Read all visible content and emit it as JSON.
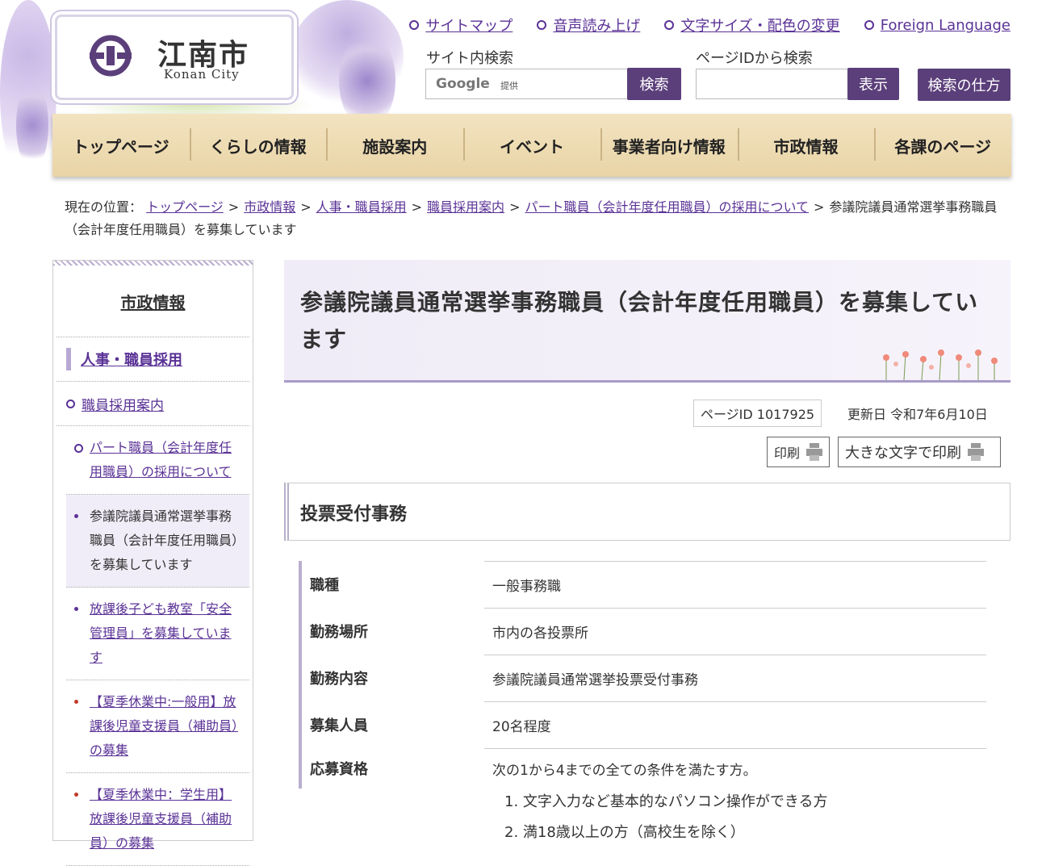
{
  "header": {
    "logo_text": "江南市",
    "logo_sub": "Konan City",
    "util_links": [
      "サイトマップ",
      "音声読み上げ",
      "文字サイズ・配色の変更",
      "Foreign Language"
    ],
    "site_search_label": "サイト内検索",
    "google_label": "Google",
    "google_provided": "提供",
    "search_button": "検索",
    "pageid_search_label": "ページIDから検索",
    "show_button": "表示",
    "howto_button": "検索の仕方"
  },
  "gnav": [
    "トップページ",
    "くらしの情報",
    "施設案内",
    "イベント",
    "事業者向け情報",
    "市政情報",
    "各課のページ"
  ],
  "breadcrumb": {
    "prefix": "現在の位置：",
    "links": [
      "トップページ",
      "市政情報",
      "人事・職員採用",
      "職員採用案内",
      "パート職員（会計年度任用職員）の採用について"
    ],
    "current": "参議院議員通常選挙事務職員（会計年度任用職員）を募集しています"
  },
  "sidenav": {
    "title": "市政情報",
    "level1": "人事・職員採用",
    "level2": "職員採用案内",
    "level3": [
      "パート職員（会計年度任用職員）の採用について",
      "参議院議員通常選挙事務職員（会計年度任用職員）を募集しています",
      "放課後子ども教室「安全管理員」を募集しています",
      "【夏季休業中:一般用】放課後児童支援員（補助員）の募集",
      "【夏季休業中：学生用】放課後児童支援員（補助員）の募集"
    ]
  },
  "main": {
    "title": "参議院議員通常選挙事務職員（会計年度任用職員）を募集しています",
    "page_id": "ページID 1017925",
    "updated": "更新日 令和7年6月10日",
    "print": "印刷",
    "print_large": "大きな文字で印刷",
    "section_title": "投票受付事務",
    "rows": [
      {
        "label": "職種",
        "value": "一般事務職"
      },
      {
        "label": "勤務場所",
        "value": "市内の各投票所"
      },
      {
        "label": "勤務内容",
        "value": "参議院議員通常選挙投票受付事務"
      },
      {
        "label": "募集人員",
        "value": "20名程度"
      },
      {
        "label": "応募資格",
        "value": "次の1から4までの全ての条件を満たす方。"
      }
    ],
    "conditions": [
      "1. 文字入力など基本的なパソコン操作ができる方",
      "2. 満18歳以上の方（高校生を除く）"
    ]
  }
}
